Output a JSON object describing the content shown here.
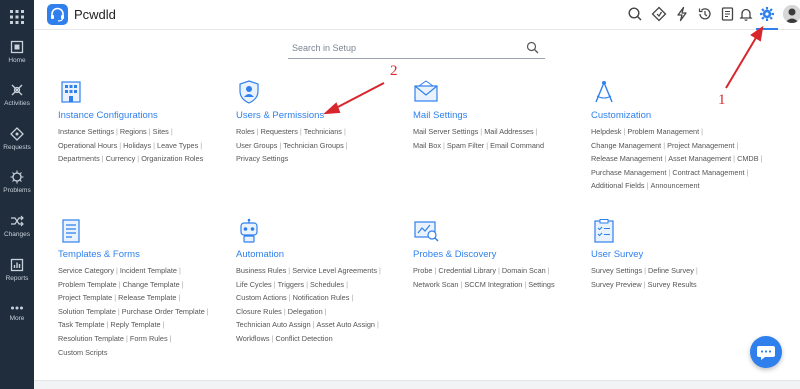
{
  "app": {
    "name": "Pcwdld"
  },
  "colors": {
    "accent": "#2f80ed",
    "sidebar_bg": "#1f2d3d",
    "annotation": "#d8262d"
  },
  "sidebar": {
    "items": [
      {
        "label": "Home",
        "icon": "home-icon"
      },
      {
        "label": "Activities",
        "icon": "activities-icon"
      },
      {
        "label": "Requests",
        "icon": "requests-icon"
      },
      {
        "label": "Problems",
        "icon": "problems-icon"
      },
      {
        "label": "Changes",
        "icon": "changes-icon"
      },
      {
        "label": "Reports",
        "icon": "reports-icon"
      },
      {
        "label": "More",
        "icon": "more-icon"
      }
    ]
  },
  "topbar": {
    "icons": [
      "search-icon",
      "tag-icon",
      "lightning-icon",
      "history-icon",
      "notes-icon",
      "bell-icon",
      "gear-icon",
      "avatar"
    ]
  },
  "search": {
    "placeholder": "Search in Setup"
  },
  "sections": [
    {
      "title": "Instance Configurations",
      "icon": "building-icon",
      "lines": [
        [
          "Instance Settings",
          "Regions",
          "Sites"
        ],
        [
          "Operational Hours",
          "Holidays",
          "Leave Types"
        ],
        [
          "Departments",
          "Currency",
          "Organization Roles"
        ]
      ]
    },
    {
      "title": "Users & Permissions",
      "icon": "user-shield-icon",
      "lines": [
        [
          "Roles",
          "Requesters",
          "Technicians"
        ],
        [
          "User Groups",
          "Technician Groups"
        ],
        [
          "Privacy Settings"
        ]
      ]
    },
    {
      "title": "Mail Settings",
      "icon": "envelope-icon",
      "lines": [
        [
          "Mail Server Settings",
          "Mail Addresses"
        ],
        [
          "Mail Box",
          "Spam Filter",
          "Email Command"
        ]
      ]
    },
    {
      "title": "Customization",
      "icon": "compass-icon",
      "lines": [
        [
          "Helpdesk",
          "Problem Management"
        ],
        [
          "Change Management",
          "Project Management"
        ],
        [
          "Release Management",
          "Asset Management",
          "CMDB"
        ],
        [
          "Purchase Management",
          "Contract Management"
        ],
        [
          "Additional Fields",
          "Announcement"
        ]
      ]
    },
    {
      "title": "Templates & Forms",
      "icon": "template-icon",
      "lines": [
        [
          "Service Category",
          "Incident Template"
        ],
        [
          "Problem Template",
          "Change Template"
        ],
        [
          "Project Template",
          "Release Template"
        ],
        [
          "Solution Template",
          "Purchase Order Template"
        ],
        [
          "Task Template",
          "Reply Template"
        ],
        [
          "Resolution Template",
          "Form Rules"
        ],
        [
          "Custom Scripts"
        ]
      ]
    },
    {
      "title": "Automation",
      "icon": "robot-icon",
      "lines": [
        [
          "Business Rules",
          "Service Level Agreements"
        ],
        [
          "Life Cycles",
          "Triggers",
          "Schedules"
        ],
        [
          "Custom Actions",
          "Notification Rules"
        ],
        [
          "Closure Rules",
          "Delegation"
        ],
        [
          "Technician Auto Assign",
          "Asset Auto Assign"
        ],
        [
          "Workflows",
          "Conflict Detection"
        ]
      ]
    },
    {
      "title": "Probes & Discovery",
      "icon": "probe-icon",
      "lines": [
        [
          "Probe",
          "Credential Library",
          "Domain Scan"
        ],
        [
          "Network Scan",
          "SCCM Integration",
          "Settings"
        ]
      ]
    },
    {
      "title": "User Survey",
      "icon": "survey-icon",
      "lines": [
        [
          "Survey Settings",
          "Define Survey"
        ],
        [
          "Survey Preview",
          "Survey Results"
        ]
      ]
    }
  ],
  "annotations": {
    "label_1": "1",
    "label_2": "2"
  },
  "chat": {
    "icon": "chat-icon"
  }
}
